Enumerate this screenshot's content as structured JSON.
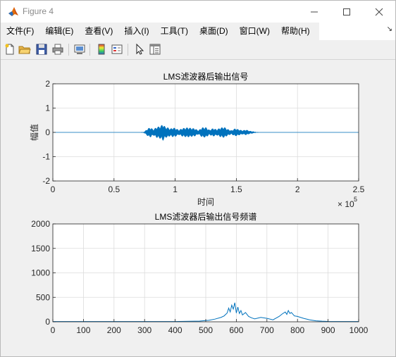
{
  "window": {
    "title": "Figure 4"
  },
  "menu": {
    "items": [
      "文件(F)",
      "编辑(E)",
      "查看(V)",
      "插入(I)",
      "工具(T)",
      "桌面(D)",
      "窗口(W)",
      "帮助(H)"
    ]
  },
  "toolbar": {
    "icons": [
      "new-file-icon",
      "open-file-icon",
      "save-icon",
      "print-icon",
      "link-figure-icon",
      "colorbar-icon",
      "legend-icon",
      "pointer-icon",
      "property-editor-icon"
    ]
  },
  "chart_data": [
    {
      "type": "line",
      "title": "LMS滤波器后输出信号",
      "xlabel": "时间",
      "ylabel": "幅值",
      "xlim": [
        0,
        250000
      ],
      "ylim": [
        -2,
        2
      ],
      "xticks": [
        0,
        0.5,
        1,
        1.5,
        2,
        2.5
      ],
      "xtick_labels": [
        "0",
        "0.5",
        "1",
        "1.5",
        "2",
        "2.5"
      ],
      "yticks": [
        -2,
        -1,
        0,
        1,
        2
      ],
      "ytick_labels": [
        "-2",
        "-1",
        "0",
        "1",
        "2"
      ],
      "x_exponent_base": "× 10",
      "x_exponent_power": "5",
      "grid": true,
      "color": "#0072BD",
      "series": [
        {
          "x": [
            0,
            74000,
            75000,
            78000,
            80000,
            82000,
            85000,
            88000,
            90000,
            92000,
            94000,
            96000,
            98000,
            100000,
            103000,
            106000,
            110000,
            113000,
            116000,
            119000,
            122000,
            125000,
            128000,
            131000,
            134000,
            137000,
            140000,
            143000,
            146000,
            149000,
            152000,
            155000,
            158000,
            161000,
            164000,
            166000,
            250000
          ],
          "env": [
            0,
            0,
            0.04,
            0.17,
            0.2,
            0.12,
            0.22,
            0.26,
            0.34,
            0.22,
            0.2,
            0.15,
            0.19,
            0.18,
            0.1,
            0.17,
            0.2,
            0.18,
            0.16,
            0.08,
            0.2,
            0.21,
            0.1,
            0.17,
            0.12,
            0.19,
            0.22,
            0.13,
            0.08,
            0.16,
            0.12,
            0.08,
            0.11,
            0.06,
            0.04,
            0,
            0
          ]
        }
      ]
    },
    {
      "type": "line",
      "title": "LMS滤波器后输出信号频谱",
      "xlabel": "",
      "ylabel": "",
      "xlim": [
        0,
        1000
      ],
      "ylim": [
        0,
        2000
      ],
      "xticks": [
        0,
        100,
        200,
        300,
        400,
        500,
        600,
        700,
        800,
        900,
        1000
      ],
      "xtick_labels": [
        "0",
        "100",
        "200",
        "300",
        "400",
        "500",
        "600",
        "700",
        "800",
        "900",
        "1000"
      ],
      "yticks": [
        0,
        500,
        1000,
        1500,
        2000
      ],
      "ytick_labels": [
        "0",
        "500",
        "1000",
        "1500",
        "2000"
      ],
      "grid": true,
      "color": "#0072BD",
      "series": [
        {
          "x": [
            0,
            400,
            480,
            510,
            530,
            550,
            560,
            570,
            575,
            580,
            585,
            590,
            595,
            600,
            605,
            610,
            615,
            620,
            630,
            640,
            650,
            660,
            680,
            700,
            720,
            740,
            750,
            760,
            765,
            770,
            775,
            780,
            790,
            800,
            820,
            840,
            860,
            880,
            900,
            1000
          ],
          "y": [
            5,
            6,
            15,
            30,
            55,
            90,
            120,
            180,
            280,
            200,
            340,
            260,
            390,
            180,
            300,
            170,
            230,
            140,
            190,
            110,
            80,
            60,
            90,
            70,
            40,
            110,
            160,
            200,
            150,
            230,
            170,
            190,
            120,
            110,
            70,
            40,
            20,
            12,
            8,
            5
          ]
        }
      ]
    }
  ]
}
